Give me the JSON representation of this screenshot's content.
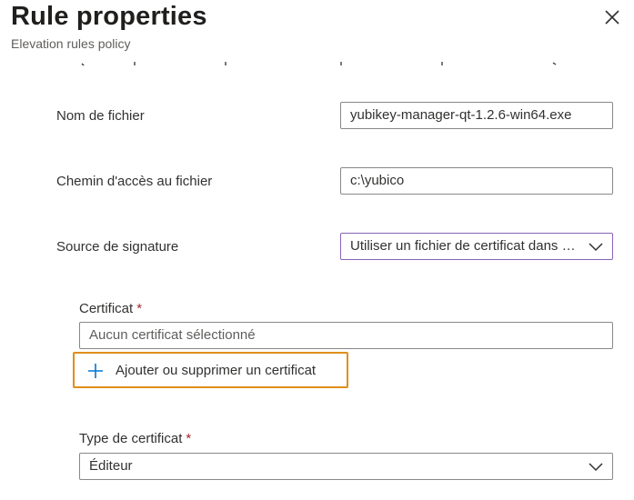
{
  "header": {
    "title": "Rule properties",
    "subtitle": "Elevation rules policy"
  },
  "form": {
    "file_name": {
      "label": "Nom de fichier",
      "value": "yubikey-manager-qt-1.2.6-win64.exe"
    },
    "file_path": {
      "label": "Chemin d'accès au fichier",
      "value": "c:\\yubico"
    },
    "signature_source": {
      "label": "Source de signature",
      "selected": "Utiliser un fichier de certificat dans le stockage local"
    },
    "certificate": {
      "label": "Certificat",
      "required_marker": "*",
      "placeholder": "Aucun certificat sélectionné"
    },
    "add_certificate_button": {
      "label": "Ajouter ou supprimer un certificat"
    },
    "certificate_type": {
      "label": "Type de certificat",
      "required_marker": "*",
      "selected": "Éditeur"
    }
  },
  "colors": {
    "focus_border": "#8764b8",
    "highlight_border": "#e08e1a",
    "plus_icon": "#0078d4",
    "required": "#a4262c"
  },
  "icons": {
    "close": "close-icon",
    "dropdown": "chevron-down-icon",
    "add": "plus-icon"
  }
}
